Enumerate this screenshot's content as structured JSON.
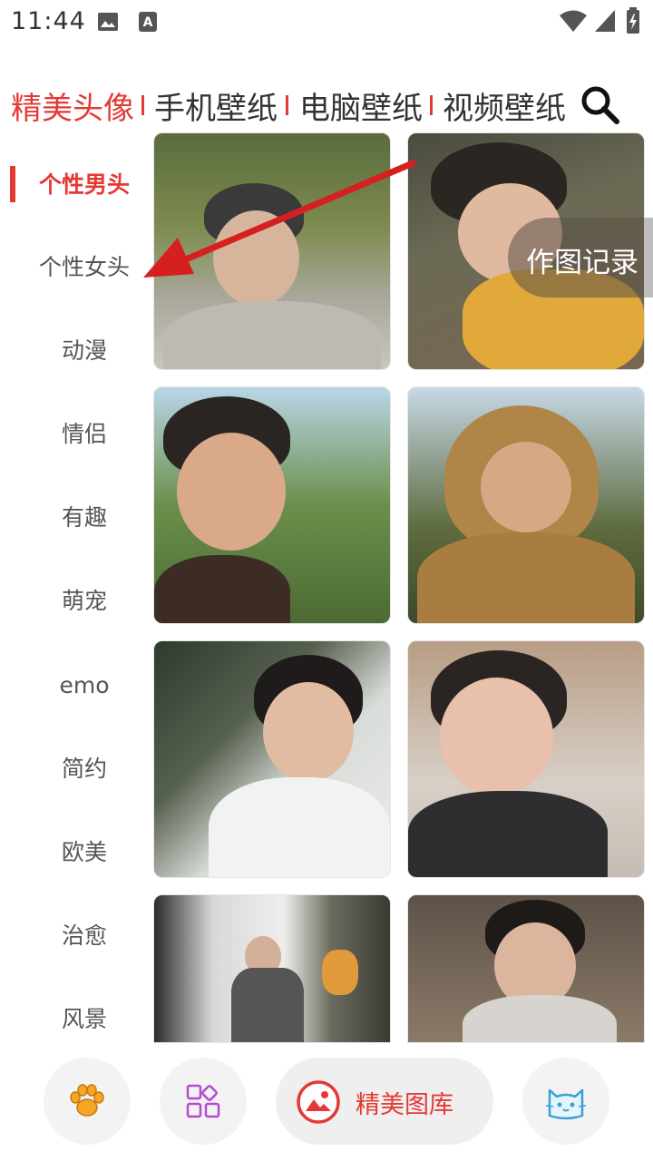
{
  "status_bar": {
    "time": "11:44"
  },
  "top_tabs": [
    {
      "label": "精美头像",
      "active": true
    },
    {
      "label": "手机壁纸",
      "active": false
    },
    {
      "label": "电脑壁纸",
      "active": false
    },
    {
      "label": "视频壁纸",
      "active": false
    }
  ],
  "sidebar": {
    "items": [
      {
        "label": "个性男头",
        "active": true
      },
      {
        "label": "个性女头"
      },
      {
        "label": "动漫"
      },
      {
        "label": "情侣"
      },
      {
        "label": "有趣"
      },
      {
        "label": "萌宠"
      },
      {
        "label": "emo"
      },
      {
        "label": "简约"
      },
      {
        "label": "欧美"
      },
      {
        "label": "治愈"
      },
      {
        "label": "风景"
      }
    ]
  },
  "record_button": {
    "label": "作图记录"
  },
  "bottom_nav": {
    "items": [
      {
        "icon": "paw-icon"
      },
      {
        "icon": "grid-icon"
      },
      {
        "icon": "gallery-icon",
        "label": "精美图库",
        "active": true
      },
      {
        "icon": "cat-icon"
      }
    ]
  },
  "colors": {
    "accent": "#e53935",
    "text": "#333333",
    "muted": "#555555"
  }
}
